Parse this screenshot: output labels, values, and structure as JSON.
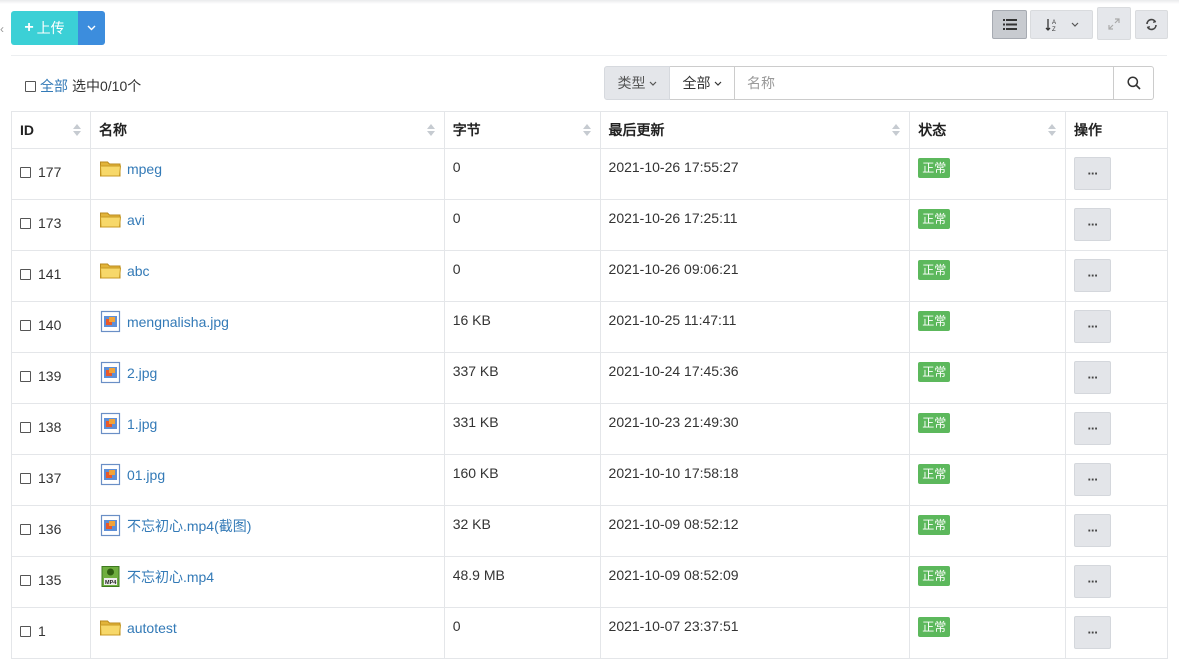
{
  "toolbar": {
    "upload_label": "上传",
    "upload_color": "#3bd0d6",
    "caret_color": "#3c8ddd",
    "icons": [
      "list-view-icon",
      "sort-az-icon",
      "expand-icon",
      "refresh-icon"
    ]
  },
  "selection": {
    "all_label": "全部",
    "count_text": "选中0/10个"
  },
  "filter": {
    "type_label": "类型",
    "scope_label": "全部",
    "search_placeholder": "名称"
  },
  "table": {
    "headers": [
      "ID",
      "名称",
      "字节",
      "最后更新",
      "状态",
      "操作"
    ],
    "rows": [
      {
        "id": "177",
        "name": "mpeg",
        "icon": "folder-icon",
        "size": "0",
        "updated": "2021-10-26 17:55:27",
        "status": "正常"
      },
      {
        "id": "173",
        "name": "avi",
        "icon": "folder-icon",
        "size": "0",
        "updated": "2021-10-26 17:25:11",
        "status": "正常"
      },
      {
        "id": "141",
        "name": "abc",
        "icon": "folder-icon",
        "size": "0",
        "updated": "2021-10-26 09:06:21",
        "status": "正常"
      },
      {
        "id": "140",
        "name": "mengnalisha.jpg",
        "icon": "image-file-icon",
        "size": "16 KB",
        "updated": "2021-10-25 11:47:11",
        "status": "正常"
      },
      {
        "id": "139",
        "name": "2.jpg",
        "icon": "image-file-icon",
        "size": "337 KB",
        "updated": "2021-10-24 17:45:36",
        "status": "正常"
      },
      {
        "id": "138",
        "name": "1.jpg",
        "icon": "image-file-icon",
        "size": "331 KB",
        "updated": "2021-10-23 21:49:30",
        "status": "正常"
      },
      {
        "id": "137",
        "name": "01.jpg",
        "icon": "image-file-icon",
        "size": "160 KB",
        "updated": "2021-10-10 17:58:18",
        "status": "正常"
      },
      {
        "id": "136",
        "name": "不忘初心.mp4(截图)",
        "icon": "image-file-icon",
        "size": "32 KB",
        "updated": "2021-10-09 08:52:12",
        "status": "正常"
      },
      {
        "id": "135",
        "name": "不忘初心.mp4",
        "icon": "mp4-file-icon",
        "size": "48.9 MB",
        "updated": "2021-10-09 08:52:09",
        "status": "正常"
      },
      {
        "id": "1",
        "name": "autotest",
        "icon": "folder-icon",
        "size": "0",
        "updated": "2021-10-07 23:37:51",
        "status": "正常"
      }
    ],
    "op_label": "···",
    "status_color": "#5cb85c"
  }
}
